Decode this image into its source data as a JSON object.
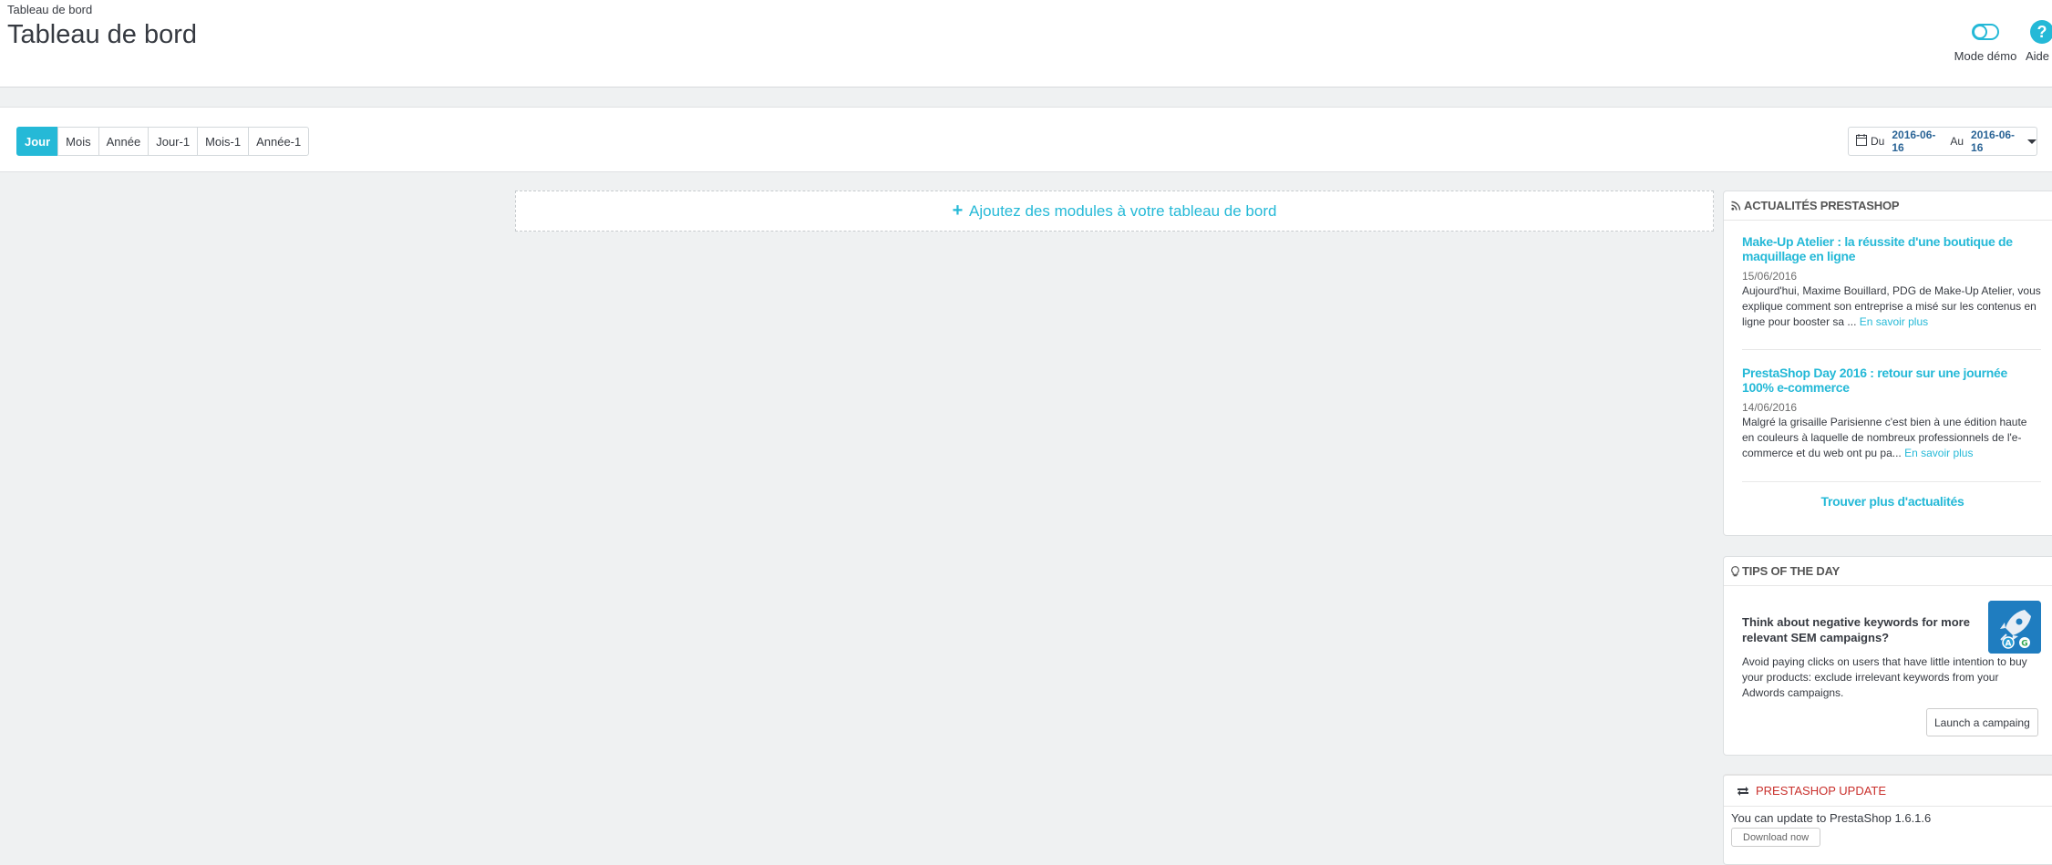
{
  "header": {
    "breadcrumb": "Tableau de bord",
    "title": "Tableau de bord",
    "demo_label": "Mode démo",
    "help_label": "Aide"
  },
  "filters": {
    "periods": [
      "Jour",
      "Mois",
      "Année",
      "Jour-1",
      "Mois-1",
      "Année-1"
    ],
    "active": "Jour",
    "date_prefix": "Du",
    "date_from": "2016-06-16",
    "date_middle": "Au",
    "date_to": "2016-06-16"
  },
  "add_modules": {
    "plus": "+",
    "label": "Ajoutez des modules à votre tableau de bord"
  },
  "news": {
    "heading": "Actualités PrestaShop",
    "items": [
      {
        "title": "Make-Up Atelier : la réussite d'une boutique de maquillage en ligne",
        "date": "15/06/2016",
        "text": "Aujourd'hui, Maxime Bouillard, PDG de Make-Up Atelier, vous explique comment son entreprise a misé sur les contenus en ligne pour booster sa ...",
        "more": "En savoir plus"
      },
      {
        "title": "PrestaShop Day 2016 : retour sur une journée 100% e-commerce",
        "date": "14/06/2016",
        "text": "Malgré la grisaille Parisienne c'est bien à une édition haute en couleurs à laquelle de nombreux professionnels de l'e-commerce et du web ont pu pa...",
        "more": "En savoir plus"
      }
    ],
    "more_news": "Trouver plus d'actualités"
  },
  "tips": {
    "heading": "Tips of the day",
    "title": "Think about negative keywords for more relevant SEM campaigns?",
    "text": "Avoid paying clicks on users that have little intention to buy your products: exclude irrelevant keywords from your Adwords campaigns.",
    "button": "Launch a campaing"
  },
  "update": {
    "heading": "PrestaShop update",
    "text": "You can update to PrestaShop 1.6.1.6",
    "button": "Download now"
  },
  "colors": {
    "accent": "#25b9d7",
    "update_red": "#c9302c"
  }
}
